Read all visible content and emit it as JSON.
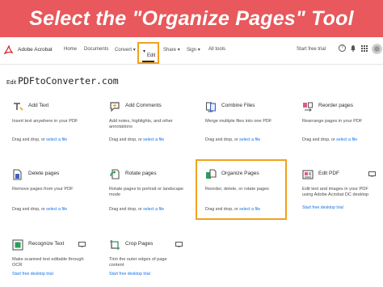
{
  "banner": {
    "title": "Select the \"Organize Pages\" Tool"
  },
  "topbar": {
    "brand": "Adobe Acrobat",
    "nav": [
      "Home",
      "Documents",
      "Convert",
      "Edit",
      "Share",
      "Sign",
      "All tools"
    ],
    "trial": "Start free trial",
    "help": "?"
  },
  "watermark": {
    "edit": "Edit",
    "site": "PDFtoConverter.com"
  },
  "tools": [
    {
      "title": "Add Text",
      "desc": "Insert text anywhere in your PDF",
      "drag": "Drag and drop, or",
      "link": "select a file"
    },
    {
      "title": "Add Comments",
      "desc": "Add notes, highlights, and other annotations",
      "drag": "Drag and drop, or",
      "link": "select a file"
    },
    {
      "title": "Combine Files",
      "desc": "Merge multiple files into one PDF",
      "drag": "Drag and drop, or",
      "link": "select a file"
    },
    {
      "title": "Reorder pages",
      "desc": "Rearrange pages in your PDF",
      "drag": "Drag and drop, or",
      "link": "select a file"
    },
    {
      "title": "Delete pages",
      "desc": "Remove pages from your PDF",
      "drag": "Drag and drop, or",
      "link": "select a file"
    },
    {
      "title": "Rotate pages",
      "desc": "Rotate pages to portrait or landscape mode",
      "drag": "Drag and drop, or",
      "link": "select a file"
    },
    {
      "title": "Organize Pages",
      "desc": "Reorder, delete, or rotate pages",
      "drag": "Drag and drop, or",
      "link": "select a file"
    },
    {
      "title": "Edit PDF",
      "desc": "Edit text and images in your PDF using Adobe Acrobat DC desktop",
      "link": "Start free desktop trial"
    },
    {
      "title": "Recognize Text",
      "desc": "Make scanned text editable through OCR",
      "link": "Start free desktop trial"
    },
    {
      "title": "Crop Pages",
      "desc": "Trim the outer edges of page content",
      "link": "Start free desktop trial"
    }
  ],
  "colors": {
    "banner": "#e8585c",
    "highlight": "#f0a21c",
    "link": "#1473e6"
  }
}
